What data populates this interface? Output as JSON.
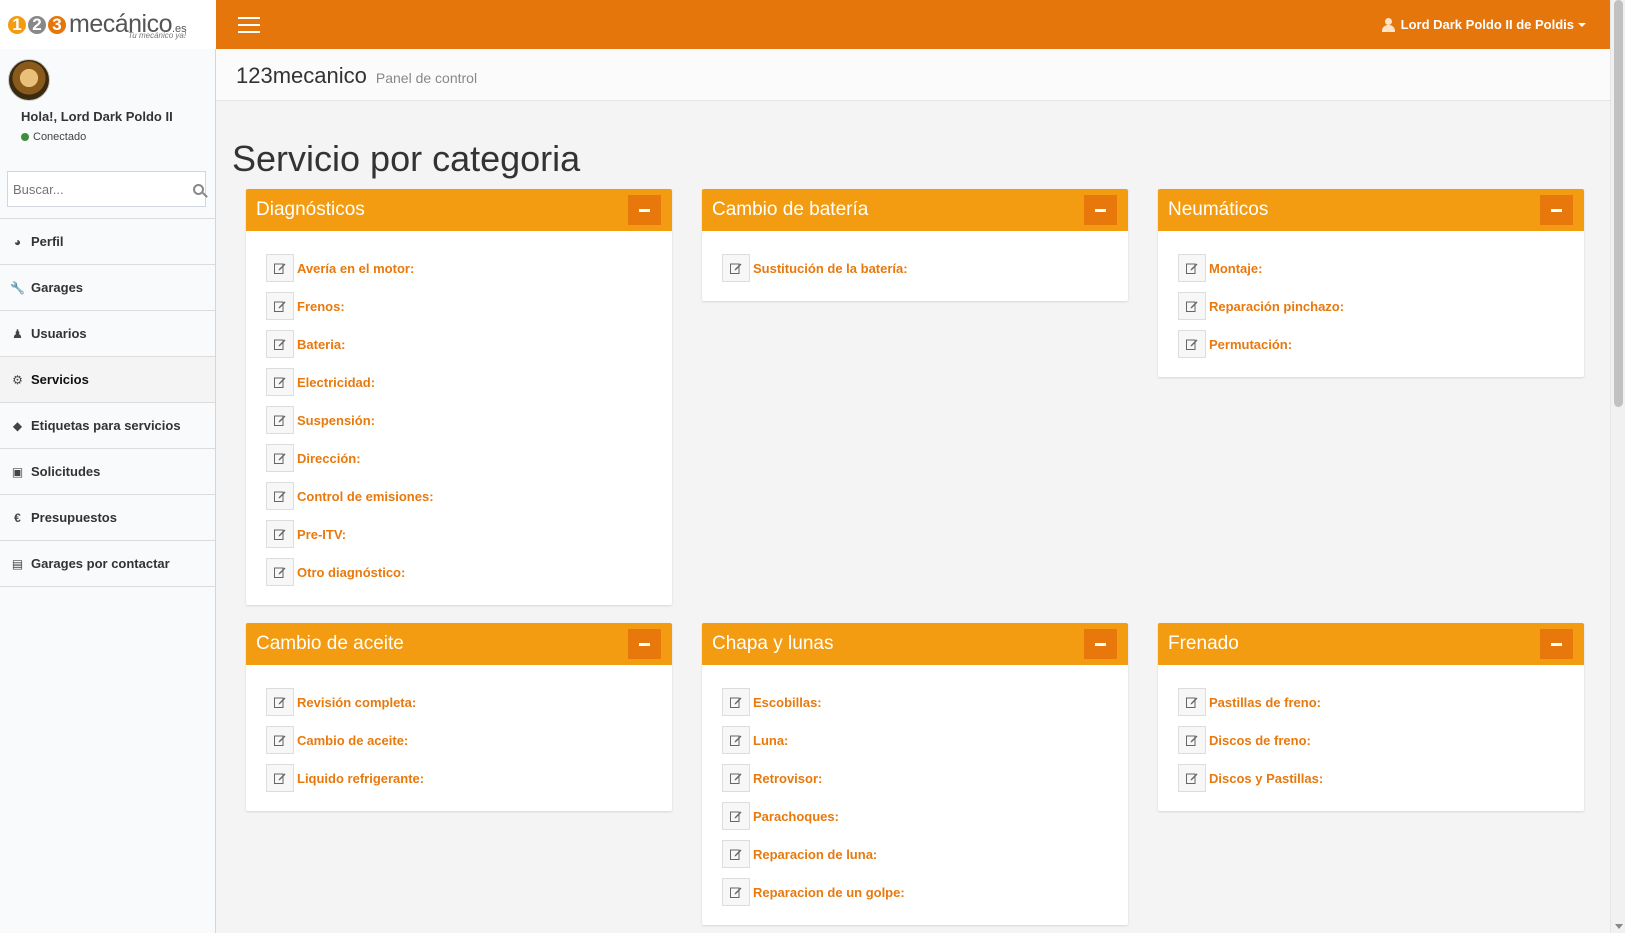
{
  "header": {
    "logo_digits": [
      "1",
      "2",
      "3"
    ],
    "logo_word": "mecánico",
    "logo_tld": ".es",
    "logo_tagline": "Tu mecánico ya!",
    "user_name": "Lord Dark Poldo II de Poldis"
  },
  "sidebar": {
    "greeting": "Hola!, Lord Dark Poldo II",
    "status": "Conectado",
    "search_placeholder": "Buscar...",
    "items": [
      {
        "label": "Perfil",
        "icon": "dashboard-icon"
      },
      {
        "label": "Garages",
        "icon": "wrench-icon"
      },
      {
        "label": "Usuarios",
        "icon": "users-icon"
      },
      {
        "label": "Servicios",
        "icon": "gears-icon"
      },
      {
        "label": "Etiquetas para servicios",
        "icon": "tag-icon"
      },
      {
        "label": "Solicitudes",
        "icon": "money-icon"
      },
      {
        "label": "Presupuestos",
        "icon": "euro-icon"
      },
      {
        "label": "Garages por contactar",
        "icon": "book-icon"
      }
    ]
  },
  "content": {
    "brand": "123mecanico",
    "subtitle": "Panel de control",
    "page_title": "Servicio por categoria",
    "categories": [
      {
        "title": "Diagnósticos",
        "services": [
          "Avería en el motor:",
          "Frenos:",
          "Bateria:",
          "Electricidad:",
          "Suspensión:",
          "Dirección:",
          "Control de emisiones:",
          "Pre-ITV:",
          "Otro diagnóstico:"
        ]
      },
      {
        "title": "Cambio de batería",
        "services": [
          "Sustitución de la batería:"
        ]
      },
      {
        "title": "Neumáticos",
        "services": [
          "Montaje:",
          "Reparación pinchazo:",
          "Permutación:"
        ]
      },
      {
        "title": "Cambio de aceite",
        "services": [
          "Revisión completa:",
          "Cambio de aceite:",
          "Liquido refrigerante:"
        ]
      },
      {
        "title": "Chapa y lunas",
        "services": [
          "Escobillas:",
          "Luna:",
          "Retrovisor:",
          "Parachoques:",
          "Reparacion de luna:",
          "Reparacion de un golpe:"
        ]
      },
      {
        "title": "Frenado",
        "services": [
          "Pastillas de freno:",
          "Discos de freno:",
          "Discos y Pastillas:"
        ]
      }
    ]
  },
  "colors": {
    "topbar": "#e5760b",
    "box_header": "#f39c12",
    "collapse_button": "#e8770c",
    "link": "#e8790d",
    "logo_digit_1": "#f39c12",
    "logo_digit_2": "#888888",
    "logo_digit_3": "#e5760b"
  }
}
